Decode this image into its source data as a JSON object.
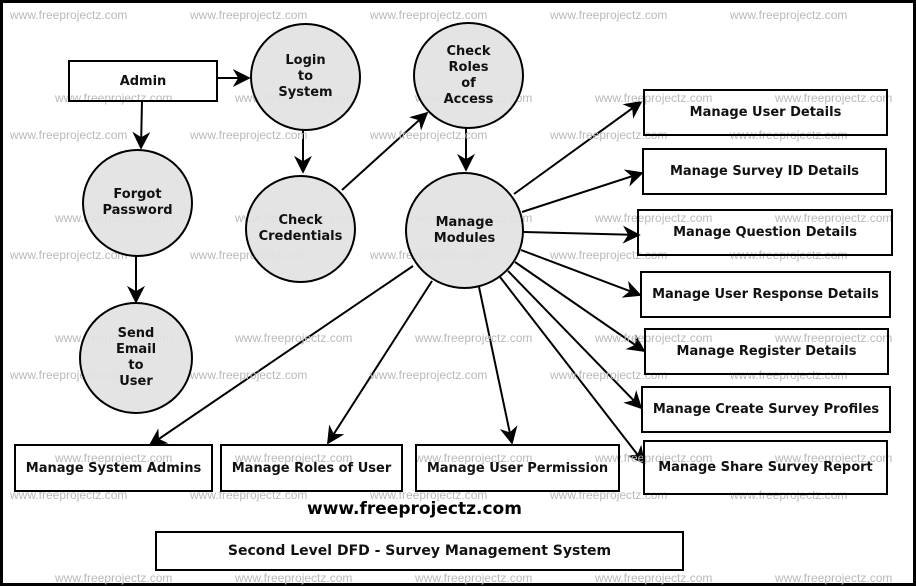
{
  "diagram": {
    "title": "Second Level DFD - Survey Management System",
    "website": "www.freeprojectz.com",
    "watermark_text": "www.freeprojectz.com",
    "colors": {
      "process_fill": "#e2e2e2",
      "stroke": "#000000",
      "watermark": "#b9b9b9"
    },
    "entities": {
      "admin": "Admin",
      "user_details": "Manage User Details",
      "survey_id": "Manage Survey ID Details",
      "question": "Manage Question Details",
      "user_response": "Manage User Response Details",
      "register": "Manage Register Details",
      "create_profiles": "Manage Create Survey Profiles",
      "share_report": "Manage Share Survey Report",
      "system_admins": "Manage System Admins",
      "roles_of_user": "Manage Roles of User",
      "user_permission": "Manage User Permission"
    },
    "processes": {
      "login": "Login\nto\nSystem",
      "check_roles": "Check\nRoles\nof\nAccess",
      "forgot_password": "Forgot\nPassword",
      "check_credentials": "Check\nCredentials",
      "manage_modules": "Manage\nModules",
      "send_email": "Send\nEmail\nto\nUser"
    },
    "flows": [
      [
        "Admin",
        "Login to System"
      ],
      [
        "Admin",
        "Forgot Password"
      ],
      [
        "Login to System",
        "Check Credentials"
      ],
      [
        "Check Credentials",
        "Check Roles of Access"
      ],
      [
        "Check Roles of Access",
        "Manage Modules"
      ],
      [
        "Forgot Password",
        "Send Email to User"
      ],
      [
        "Manage Modules",
        "Manage User Details"
      ],
      [
        "Manage Modules",
        "Manage Survey ID Details"
      ],
      [
        "Manage Modules",
        "Manage Question Details"
      ],
      [
        "Manage Modules",
        "Manage User Response Details"
      ],
      [
        "Manage Modules",
        "Manage Register Details"
      ],
      [
        "Manage Modules",
        "Manage Create Survey Profiles"
      ],
      [
        "Manage Modules",
        "Manage Share Survey Report"
      ],
      [
        "Manage Modules",
        "Manage System Admins"
      ],
      [
        "Manage Modules",
        "Manage Roles of User"
      ],
      [
        "Manage Modules",
        "Manage User Permission"
      ]
    ]
  }
}
